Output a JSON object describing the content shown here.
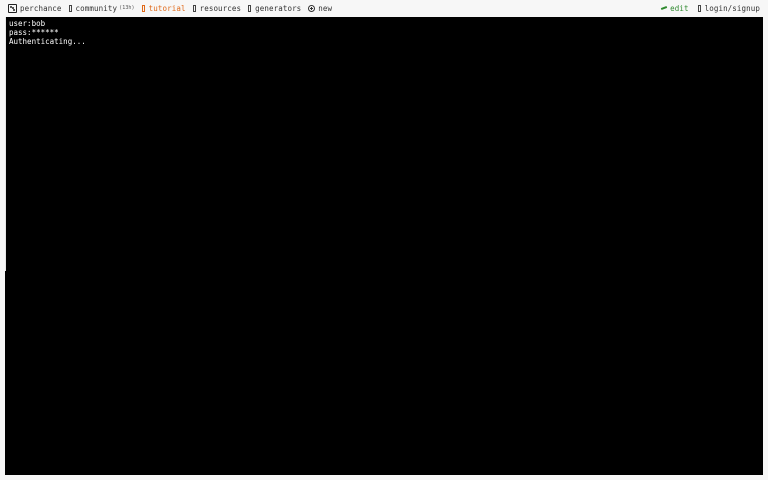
{
  "nav": {
    "brand": {
      "label": "perchance",
      "icon": "dice-icon"
    },
    "community": {
      "label": "community",
      "count": "(13h)",
      "icon": "placeholder-icon"
    },
    "tutorial": {
      "label": "tutorial",
      "icon": "placeholder-icon",
      "color": "#e06a1b"
    },
    "resources": {
      "label": "resources",
      "icon": "placeholder-icon"
    },
    "generators": {
      "label": "generators",
      "icon": "placeholder-icon"
    },
    "new": {
      "label": "new",
      "icon": "circle-plus-icon"
    },
    "edit": {
      "label": "edit",
      "icon": "pencil-icon",
      "color": "#2f8a2f"
    },
    "login": {
      "label": "login/signup",
      "icon": "placeholder-icon"
    }
  },
  "terminal": {
    "background": "#000000",
    "text_color": "#ffffff",
    "lines": [
      "user:bob",
      "pass:******",
      "Authenticating..."
    ]
  }
}
